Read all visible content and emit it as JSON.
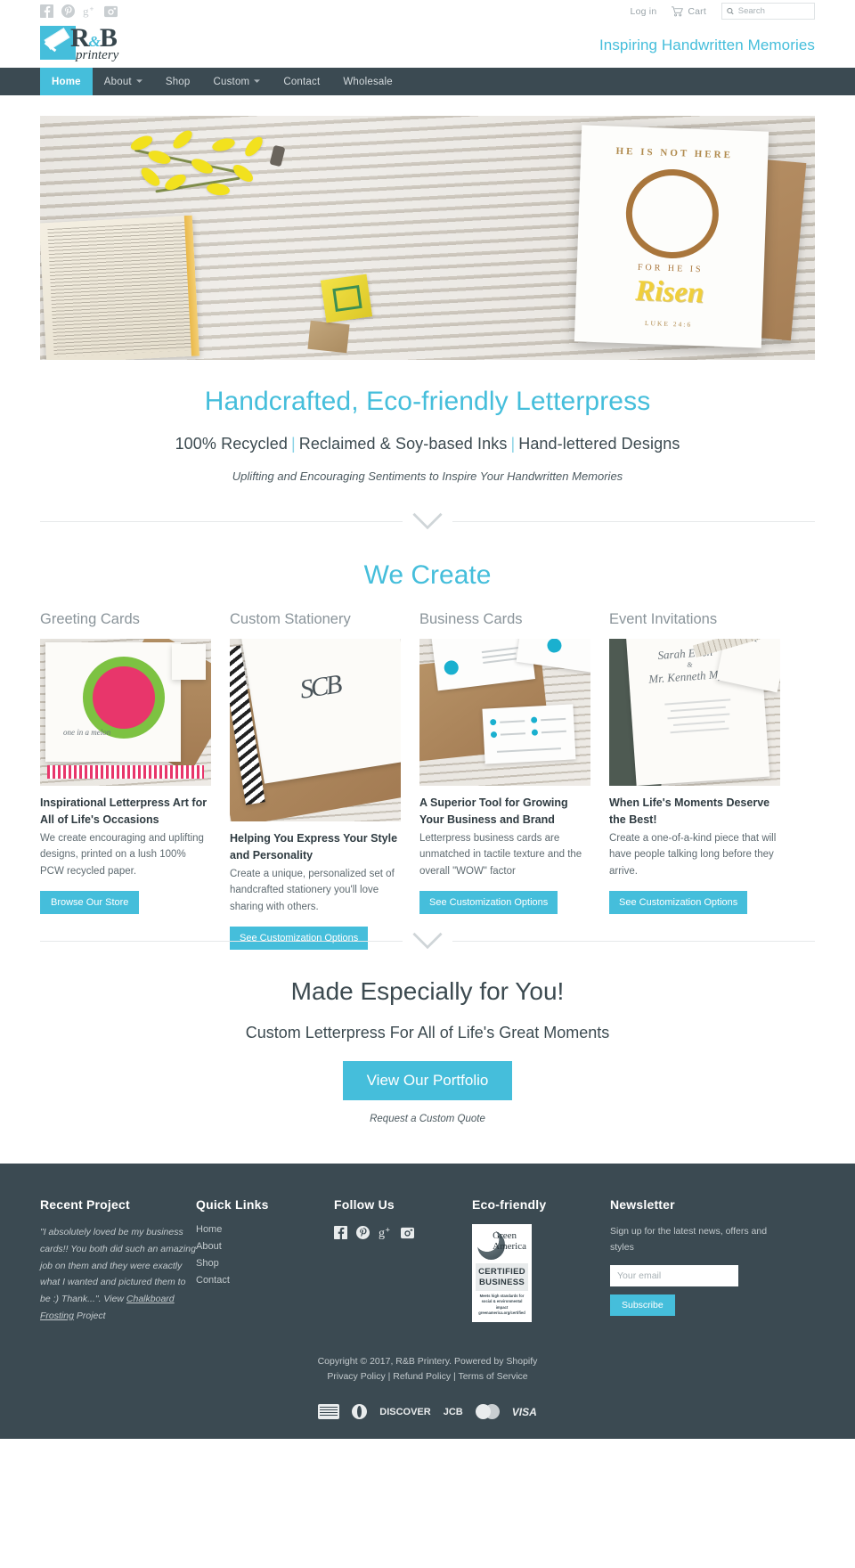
{
  "topbar": {
    "social": [
      "facebook-icon",
      "pinterest-icon",
      "googleplus-icon",
      "instagram-icon"
    ],
    "login": "Log in",
    "cart": "Cart",
    "search_placeholder": "Search"
  },
  "brand": {
    "logo_main": "R",
    "logo_amp": "&",
    "logo_b": "B",
    "logo_sub": "printery",
    "slogan": "Inspiring Handwritten Memories"
  },
  "nav": [
    {
      "label": "Home",
      "active": true,
      "caret": false
    },
    {
      "label": "About",
      "active": false,
      "caret": true
    },
    {
      "label": "Shop",
      "active": false,
      "caret": false
    },
    {
      "label": "Custom",
      "active": false,
      "caret": true
    },
    {
      "label": "Contact",
      "active": false,
      "caret": false
    },
    {
      "label": "Wholesale",
      "active": false,
      "caret": false
    }
  ],
  "hero_card": {
    "line1": "HE IS NOT HERE",
    "line2": "FOR HE IS",
    "line3": "Risen",
    "line4": "LUKE 24:6"
  },
  "hero": {
    "title": "Handcrafted, Eco-friendly Letterpress",
    "sub_a": "100% Recycled",
    "sub_b": "Reclaimed & Soy-based Inks",
    "sub_c": "Hand-lettered Designs",
    "sub2": "Uplifting and Encouraging Sentiments to Inspire Your Handwritten Memories"
  },
  "we_create": {
    "heading": "We Create",
    "cards": [
      {
        "title": "Greeting Cards",
        "heading": "Inspirational Letterpress Art for All of Life's Occasions",
        "body": "We create encouraging and uplifting designs, printed on a lush 100% PCW recycled paper.",
        "button": "Browse Our Store",
        "img_caption": "one in a melon"
      },
      {
        "title": "Custom Stationery",
        "heading": "Helping You Express Your Style and Personality",
        "body": "Create a unique, personalized set of handcrafted stationery you'll love sharing with others.",
        "button": "See Customization Options",
        "img_caption": "SCB"
      },
      {
        "title": "Business Cards",
        "heading": "A Superior Tool for Growing Your Business and Brand",
        "body": "Letterpress business cards are unmatched in tactile texture and the overall \"WOW\" factor",
        "button": "See Customization Options",
        "img_caption": ""
      },
      {
        "title": "Event Invitations",
        "heading": "When Life's Moments Deserve the Best!",
        "body": "Create a one-of-a-kind piece that will have people talking long before they arrive.",
        "button": "See Customization Options",
        "img_caption": ""
      }
    ]
  },
  "cta": {
    "heading": "Made Especially for You!",
    "subheading": "Custom Letterpress For All of Life's Great Moments",
    "button": "View Our Portfolio",
    "quote_link": "Request a Custom Quote"
  },
  "footer": {
    "recent_project": {
      "heading": "Recent Project",
      "quote_pre": "\"I absolutely loved be my business cards!! You both did such an amazing job on them and they were exactly what I wanted and pictured them to be :) Thank...\". View ",
      "quote_link": "Chalkboard Frosting",
      "quote_post": " Project"
    },
    "quick_links": {
      "heading": "Quick Links",
      "items": [
        "Home",
        "About",
        "Shop",
        "Contact"
      ]
    },
    "follow": {
      "heading": "Follow Us",
      "icons": [
        "facebook-icon",
        "pinterest-icon",
        "googleplus-icon",
        "instagram-icon"
      ]
    },
    "eco": {
      "heading": "Eco-friendly",
      "badge_name_1": "Green",
      "badge_name_2": "America",
      "badge_cert_1": "CERTIFIED",
      "badge_cert_2": "BUSINESS",
      "badge_fine_1": "Meets high standards for",
      "badge_fine_2": "social & environmental impact",
      "badge_fine_3": "greenamerica.org/certified"
    },
    "newsletter": {
      "heading": "Newsletter",
      "blurb": "Sign up for the latest news, offers and styles",
      "placeholder": "Your email",
      "button": "Subscribe"
    },
    "copyright": "Copyright © 2017, R&B Printery. Powered by Shopify",
    "legal": [
      "Privacy Policy",
      "Refund Policy",
      "Terms of Service"
    ],
    "legal_sep": " | ",
    "payments": [
      "american-express",
      "diners-club",
      "DISCOVER",
      "JCB",
      "mastercard",
      "VISA"
    ]
  },
  "colors": {
    "accent": "#45bedb",
    "dark": "#3b4a52",
    "body_text": "#5e6a70"
  }
}
